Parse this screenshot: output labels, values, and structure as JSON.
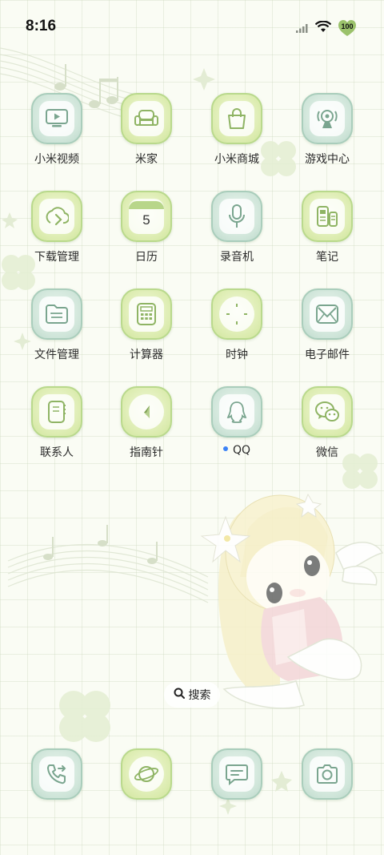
{
  "status": {
    "time": "8:16",
    "battery": "100"
  },
  "apps": [
    {
      "label": "小米视频",
      "icon": "video-icon"
    },
    {
      "label": "米家",
      "icon": "sofa-icon"
    },
    {
      "label": "小米商城",
      "icon": "shopping-bag-icon"
    },
    {
      "label": "游戏中心",
      "icon": "game-controller-icon"
    },
    {
      "label": "下载管理",
      "icon": "download-icon"
    },
    {
      "label": "日历",
      "icon": "calendar-icon",
      "day": "5"
    },
    {
      "label": "录音机",
      "icon": "microphone-icon"
    },
    {
      "label": "笔记",
      "icon": "notes-icon"
    },
    {
      "label": "文件管理",
      "icon": "folder-icon"
    },
    {
      "label": "计算器",
      "icon": "calculator-icon"
    },
    {
      "label": "时钟",
      "icon": "clock-icon"
    },
    {
      "label": "电子邮件",
      "icon": "mail-icon"
    },
    {
      "label": "联系人",
      "icon": "contacts-icon"
    },
    {
      "label": "指南针",
      "icon": "compass-icon"
    },
    {
      "label": "QQ",
      "icon": "qq-penguin-icon"
    },
    {
      "label": "微信",
      "icon": "wechat-icon"
    }
  ],
  "search": {
    "label": "搜索"
  },
  "dock": [
    {
      "icon": "phone-icon"
    },
    {
      "icon": "browser-planet-icon"
    },
    {
      "icon": "message-icon"
    },
    {
      "icon": "camera-icon"
    }
  ],
  "colors": {
    "green": "#dcecb0",
    "teal": "#cfe5d9",
    "notification_dot": "#3b82f6",
    "grid": "#c8d6ba"
  }
}
